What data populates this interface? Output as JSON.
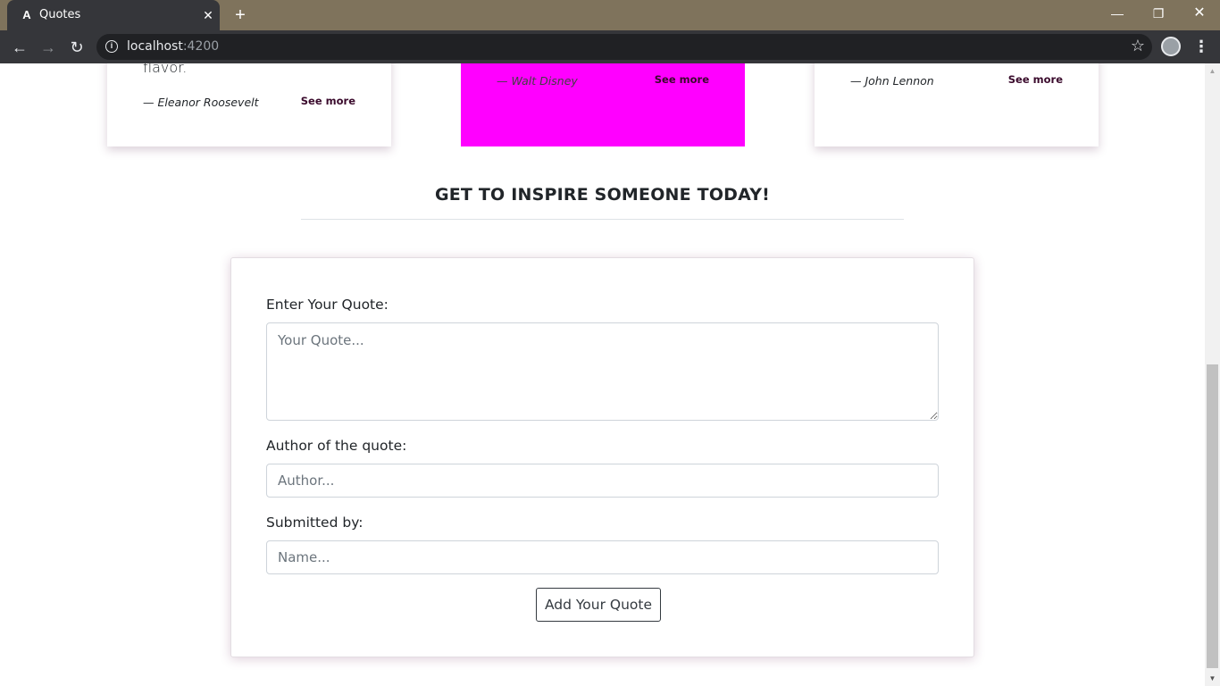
{
  "browser": {
    "tab_title": "Quotes",
    "tab_favicon_glyph": "A",
    "url_host": "localhost",
    "url_port": ":4200"
  },
  "quote_cards": [
    {
      "text": "flavor.",
      "author": "— Eleanor Roosevelt",
      "see_more": "See more",
      "background": "#ffffff"
    },
    {
      "text": "",
      "author": "— Walt Disney",
      "see_more": "See more",
      "background": "#ff00ff"
    },
    {
      "text": "",
      "author": "— John Lennon",
      "see_more": "See more",
      "background": "#ffffff"
    }
  ],
  "section": {
    "heading": "GET TO INSPIRE SOMEONE TODAY!"
  },
  "form": {
    "quote_label": "Enter Your Quote:",
    "quote_placeholder": "Your Quote...",
    "author_label": "Author of the quote:",
    "author_placeholder": "Author...",
    "submitter_label": "Submitted by:",
    "submitter_placeholder": "Name...",
    "submit_label": "Add Your Quote"
  }
}
